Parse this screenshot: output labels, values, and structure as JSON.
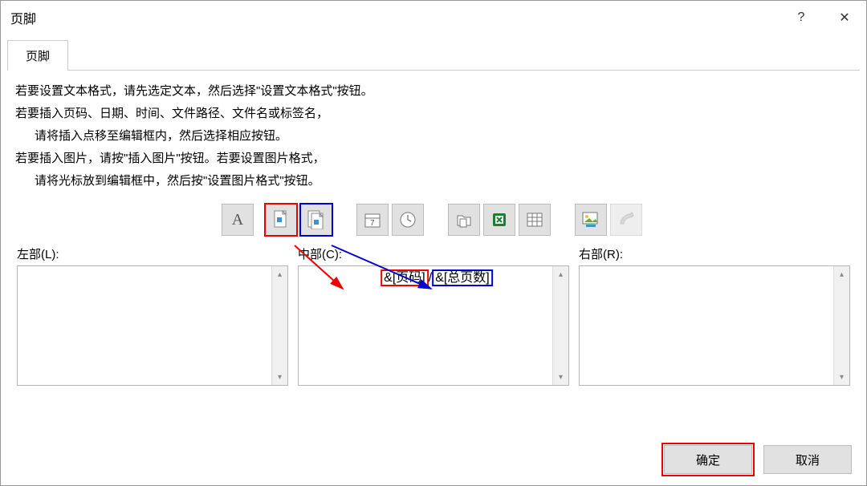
{
  "window": {
    "title": "页脚",
    "help_label": "?",
    "close_label": "✕"
  },
  "tab": {
    "label": "页脚"
  },
  "instructions": {
    "l1": "若要设置文本格式，请先选定文本，然后选择\"设置文本格式\"按钮。",
    "l2": "若要插入页码、日期、时间、文件路径、文件名或标签名，",
    "l2b": "请将插入点移至编辑框内，然后选择相应按钮。",
    "l3": "若要插入图片，请按\"插入图片\"按钮。若要设置图片格式，",
    "l3b": "请将光标放到编辑框中，然后按\"设置图片格式\"按钮。"
  },
  "toolbar": {
    "text_format": "A",
    "page_number": "page-number-icon",
    "total_pages": "total-pages-icon",
    "date": "date-icon",
    "time": "time-icon",
    "file_path": "file-path-icon",
    "file_name": "file-name-icon",
    "sheet_name": "sheet-name-icon",
    "insert_picture": "insert-picture-icon",
    "format_picture": "format-picture-icon"
  },
  "fields": {
    "left_label": "左部(L):",
    "center_label": "中部(C):",
    "right_label": "右部(R):",
    "center_page_token": "&[页码]",
    "center_sep": "/",
    "center_total_token": "&[总页数]"
  },
  "buttons": {
    "ok": "确定",
    "cancel": "取消"
  }
}
